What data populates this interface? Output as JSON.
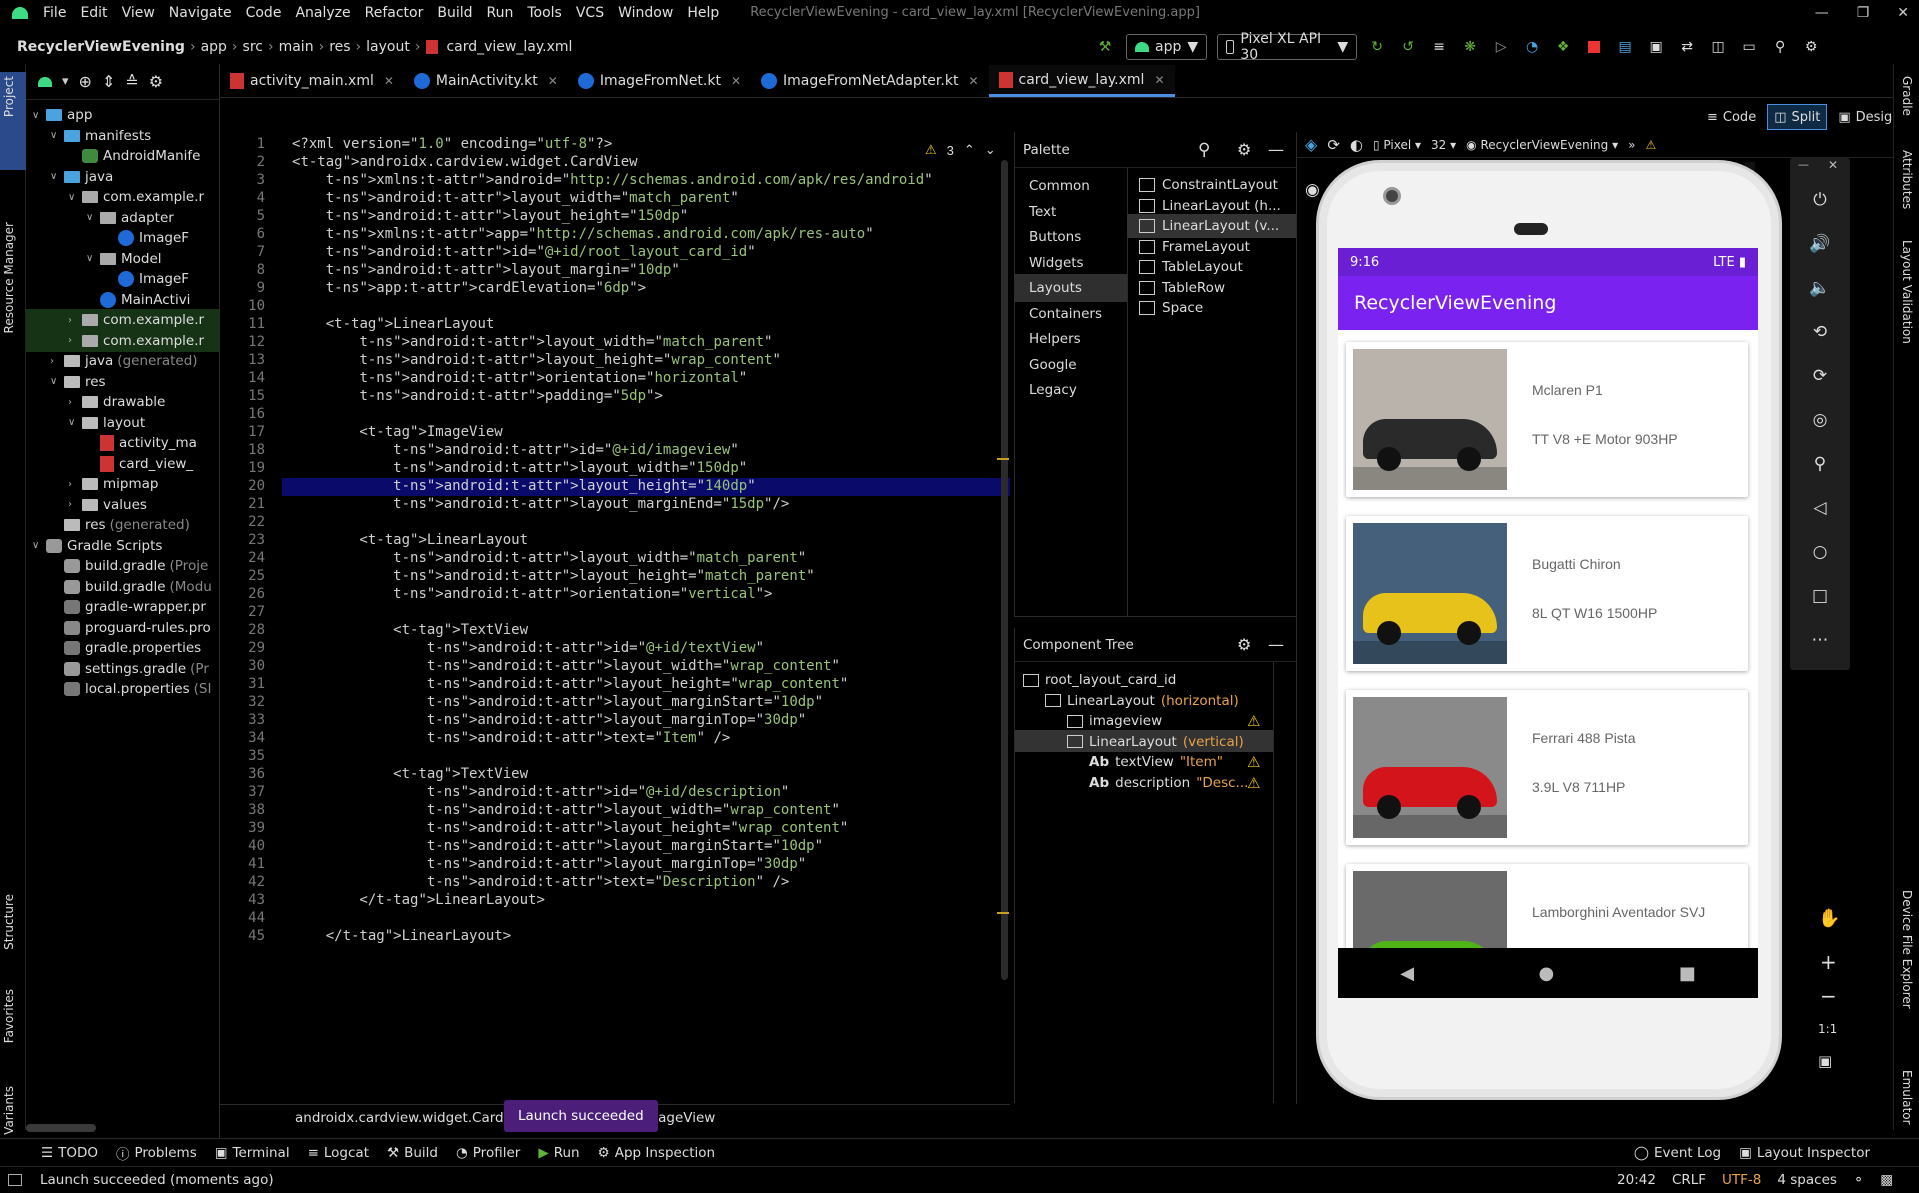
{
  "menubar": {
    "items": [
      "File",
      "Edit",
      "View",
      "Navigate",
      "Code",
      "Analyze",
      "Refactor",
      "Build",
      "Run",
      "Tools",
      "VCS",
      "Window",
      "Help"
    ],
    "window_title": "RecyclerViewEvening - card_view_lay.xml [RecyclerViewEvening.app]"
  },
  "navbar": {
    "crumbs": [
      "RecyclerViewEvening",
      "app",
      "src",
      "main",
      "res",
      "layout",
      "card_view_lay.xml"
    ],
    "run_config": "app",
    "device": "Pixel XL API 30"
  },
  "left_tool_tabs": [
    "Project",
    "Resource Manager",
    "Structure",
    "Favorites",
    "Build Variants"
  ],
  "right_tool_tabs": [
    "Gradle",
    "Attributes",
    "Layout Validation",
    "Device File Explorer",
    "Emulator"
  ],
  "project_tree": [
    {
      "label": "app",
      "indent": 0,
      "arrow": "v",
      "icon": "folder-blue"
    },
    {
      "label": "manifests",
      "indent": 1,
      "arrow": "v",
      "icon": "folder-blue"
    },
    {
      "label": "AndroidManife",
      "indent": 2,
      "arrow": "",
      "icon": "manifest"
    },
    {
      "label": "java",
      "indent": 1,
      "arrow": "v",
      "icon": "folder-blue"
    },
    {
      "label": "com.example.r",
      "indent": 2,
      "arrow": "v",
      "icon": "package"
    },
    {
      "label": "adapter",
      "indent": 3,
      "arrow": "v",
      "icon": "package"
    },
    {
      "label": "ImageF",
      "indent": 4,
      "arrow": "",
      "icon": "kotlin"
    },
    {
      "label": "Model",
      "indent": 3,
      "arrow": "v",
      "icon": "package"
    },
    {
      "label": "ImageF",
      "indent": 4,
      "arrow": "",
      "icon": "kotlin"
    },
    {
      "label": "MainActivi",
      "indent": 3,
      "arrow": "",
      "icon": "kotlin"
    },
    {
      "label": "com.example.r",
      "indent": 2,
      "arrow": ">",
      "icon": "package"
    },
    {
      "label": "com.example.r",
      "indent": 2,
      "arrow": ">",
      "icon": "package"
    },
    {
      "label": "java",
      "suffix": "(generated)",
      "indent": 1,
      "arrow": ">",
      "icon": "folder-gen"
    },
    {
      "label": "res",
      "indent": 1,
      "arrow": "v",
      "icon": "folder-res"
    },
    {
      "label": "drawable",
      "indent": 2,
      "arrow": ">",
      "icon": "folder"
    },
    {
      "label": "layout",
      "indent": 2,
      "arrow": "v",
      "icon": "folder"
    },
    {
      "label": "activity_ma",
      "indent": 3,
      "arrow": "",
      "icon": "xml"
    },
    {
      "label": "card_view_",
      "indent": 3,
      "arrow": "",
      "icon": "xml"
    },
    {
      "label": "mipmap",
      "indent": 2,
      "arrow": ">",
      "icon": "folder"
    },
    {
      "label": "values",
      "indent": 2,
      "arrow": ">",
      "icon": "folder"
    },
    {
      "label": "res",
      "suffix": "(generated)",
      "indent": 1,
      "arrow": "",
      "icon": "folder-gen"
    },
    {
      "label": "Gradle Scripts",
      "indent": 0,
      "arrow": "v",
      "icon": "gradle"
    },
    {
      "label": "build.gradle",
      "suffix": "(Proje",
      "indent": 1,
      "arrow": "",
      "icon": "gradle"
    },
    {
      "label": "build.gradle",
      "suffix": "(Modu",
      "indent": 1,
      "arrow": "",
      "icon": "gradle"
    },
    {
      "label": "gradle-wrapper.pr",
      "indent": 1,
      "arrow": "",
      "icon": "props"
    },
    {
      "label": "proguard-rules.pro",
      "indent": 1,
      "arrow": "",
      "icon": "file"
    },
    {
      "label": "gradle.properties",
      "indent": 1,
      "arrow": "",
      "icon": "props"
    },
    {
      "label": "settings.gradle",
      "suffix": "(Pr",
      "indent": 1,
      "arrow": "",
      "icon": "gradle"
    },
    {
      "label": "local.properties",
      "suffix": "(SI",
      "indent": 1,
      "arrow": "",
      "icon": "props"
    }
  ],
  "tabs": [
    {
      "label": "activity_main.xml",
      "icon": "xml"
    },
    {
      "label": "MainActivity.kt",
      "icon": "kotlin"
    },
    {
      "label": "ImageFromNet.kt",
      "icon": "kotlin"
    },
    {
      "label": "ImageFromNetAdapter.kt",
      "icon": "kotlin"
    },
    {
      "label": "card_view_lay.xml",
      "icon": "xml",
      "active": true
    }
  ],
  "view_modes": {
    "code": "Code",
    "split": "Split",
    "design": "Design"
  },
  "editor": {
    "warning_count": "3",
    "highlighted_line": 20,
    "lines": [
      "<?xml version=\"1.0\" encoding=\"utf-8\"?>",
      "<androidx.cardview.widget.CardView",
      "    xmlns:android=\"http://schemas.android.com/apk/res/android\"",
      "    android:layout_width=\"match_parent\"",
      "    android:layout_height=\"150dp\"",
      "    xmlns:app=\"http://schemas.android.com/apk/res-auto\"",
      "    android:id=\"@+id/root_layout_card_id\"",
      "    android:layout_margin=\"10dp\"",
      "    app:cardElevation=\"6dp\">",
      "",
      "    <LinearLayout",
      "        android:layout_width=\"match_parent\"",
      "        android:layout_height=\"wrap_content\"",
      "        android:orientation=\"horizontal\"",
      "        android:padding=\"5dp\">",
      "",
      "        <ImageView",
      "            android:id=\"@+id/imageview\"",
      "            android:layout_width=\"150dp\"",
      "            android:layout_height=\"140dp\"",
      "            android:layout_marginEnd=\"15dp\"/>",
      "",
      "        <LinearLayout",
      "            android:layout_width=\"match_parent\"",
      "            android:layout_height=\"match_parent\"",
      "            android:orientation=\"vertical\">",
      "",
      "            <TextView",
      "                android:id=\"@+id/textView\"",
      "                android:layout_width=\"wrap_content\"",
      "                android:layout_height=\"wrap_content\"",
      "                android:layout_marginStart=\"10dp\"",
      "                android:layout_marginTop=\"30dp\"",
      "                android:text=\"Item\" />",
      "",
      "            <TextView",
      "                android:id=\"@+id/description\"",
      "                android:layout_width=\"wrap_content\"",
      "                android:layout_height=\"wrap_content\"",
      "                android:layout_marginStart=\"10dp\"",
      "                android:layout_marginTop=\"30dp\"",
      "                android:text=\"Description\" />",
      "        </LinearLayout>",
      "",
      "    </LinearLayout>"
    ]
  },
  "editor_breadcrumb": "androidx.cardview.widget.CardView",
  "editor_breadcrumb_tail": "mageView",
  "toast": "Launch succeeded",
  "palette": {
    "title": "Palette",
    "categories": [
      "Common",
      "Text",
      "Buttons",
      "Widgets",
      "Layouts",
      "Containers",
      "Helpers",
      "Google",
      "Legacy"
    ],
    "selected_category": "Layouts",
    "items": [
      "ConstraintLayout",
      "LinearLayout (h...",
      "LinearLayout (v...",
      "FrameLayout",
      "TableLayout",
      "TableRow",
      "Space"
    ],
    "selected_item": "LinearLayout (v..."
  },
  "design_toolbar": {
    "device": "Pixel",
    "api": "32",
    "theme": "RecyclerViewEvening"
  },
  "component_tree": {
    "title": "Component Tree",
    "items": [
      {
        "label": "root_layout_card_id",
        "attr": "",
        "indent": 0,
        "icon": "card",
        "warn": false
      },
      {
        "label": "LinearLayout",
        "attr": "(horizontal)",
        "indent": 1,
        "icon": "hlinear",
        "warn": false
      },
      {
        "label": "imageview",
        "attr": "",
        "indent": 2,
        "icon": "image",
        "warn": true
      },
      {
        "label": "LinearLayout",
        "attr": "(vertical)",
        "indent": 2,
        "icon": "vlinear",
        "warn": false,
        "selected": true
      },
      {
        "label": "textView",
        "attr": "\"Item\"",
        "indent": 3,
        "icon": "text",
        "warn": true
      },
      {
        "label": "description",
        "attr": "\"Desc...",
        "indent": 3,
        "icon": "text",
        "warn": true
      }
    ]
  },
  "phone": {
    "time": "9:16",
    "network": "LTE",
    "app_title": "RecyclerViewEvening",
    "cards": [
      {
        "title": "Mclaren P1",
        "desc": "TT V8 +E Motor 903HP",
        "color": "#2a2a2a",
        "bg": "#b9b3ab"
      },
      {
        "title": "Bugatti Chiron",
        "desc": "8L QT W16 1500HP",
        "color": "#e6c21a",
        "bg": "#45607a"
      },
      {
        "title": "Ferrari 488 Pista",
        "desc": "3.9L V8 711HP",
        "color": "#d4141b",
        "bg": "#8a8a8a"
      },
      {
        "title": "Lamborghini Aventador SVJ",
        "desc": "",
        "color": "#4fb318",
        "bg": "#6a6a6a"
      }
    ]
  },
  "emulator_zoom": {
    "ratio": "1:1"
  },
  "bottom_tabs": [
    "TODO",
    "Problems",
    "Terminal",
    "Logcat",
    "Build",
    "Profiler",
    "Run",
    "App Inspection"
  ],
  "bottom_right_tabs": [
    "Event Log",
    "Layout Inspector"
  ],
  "status": {
    "message": "Launch succeeded (moments ago)",
    "position": "20:42",
    "line_sep": "CRLF",
    "encoding": "UTF-8",
    "indent": "4 spaces"
  },
  "colors": {
    "accent": "#4a8ee0",
    "app_bar": "#7a23f0",
    "status_bar": "#6a1fd4",
    "highlight_line": "#0a0a6b",
    "toast": "#4b1e7a"
  }
}
